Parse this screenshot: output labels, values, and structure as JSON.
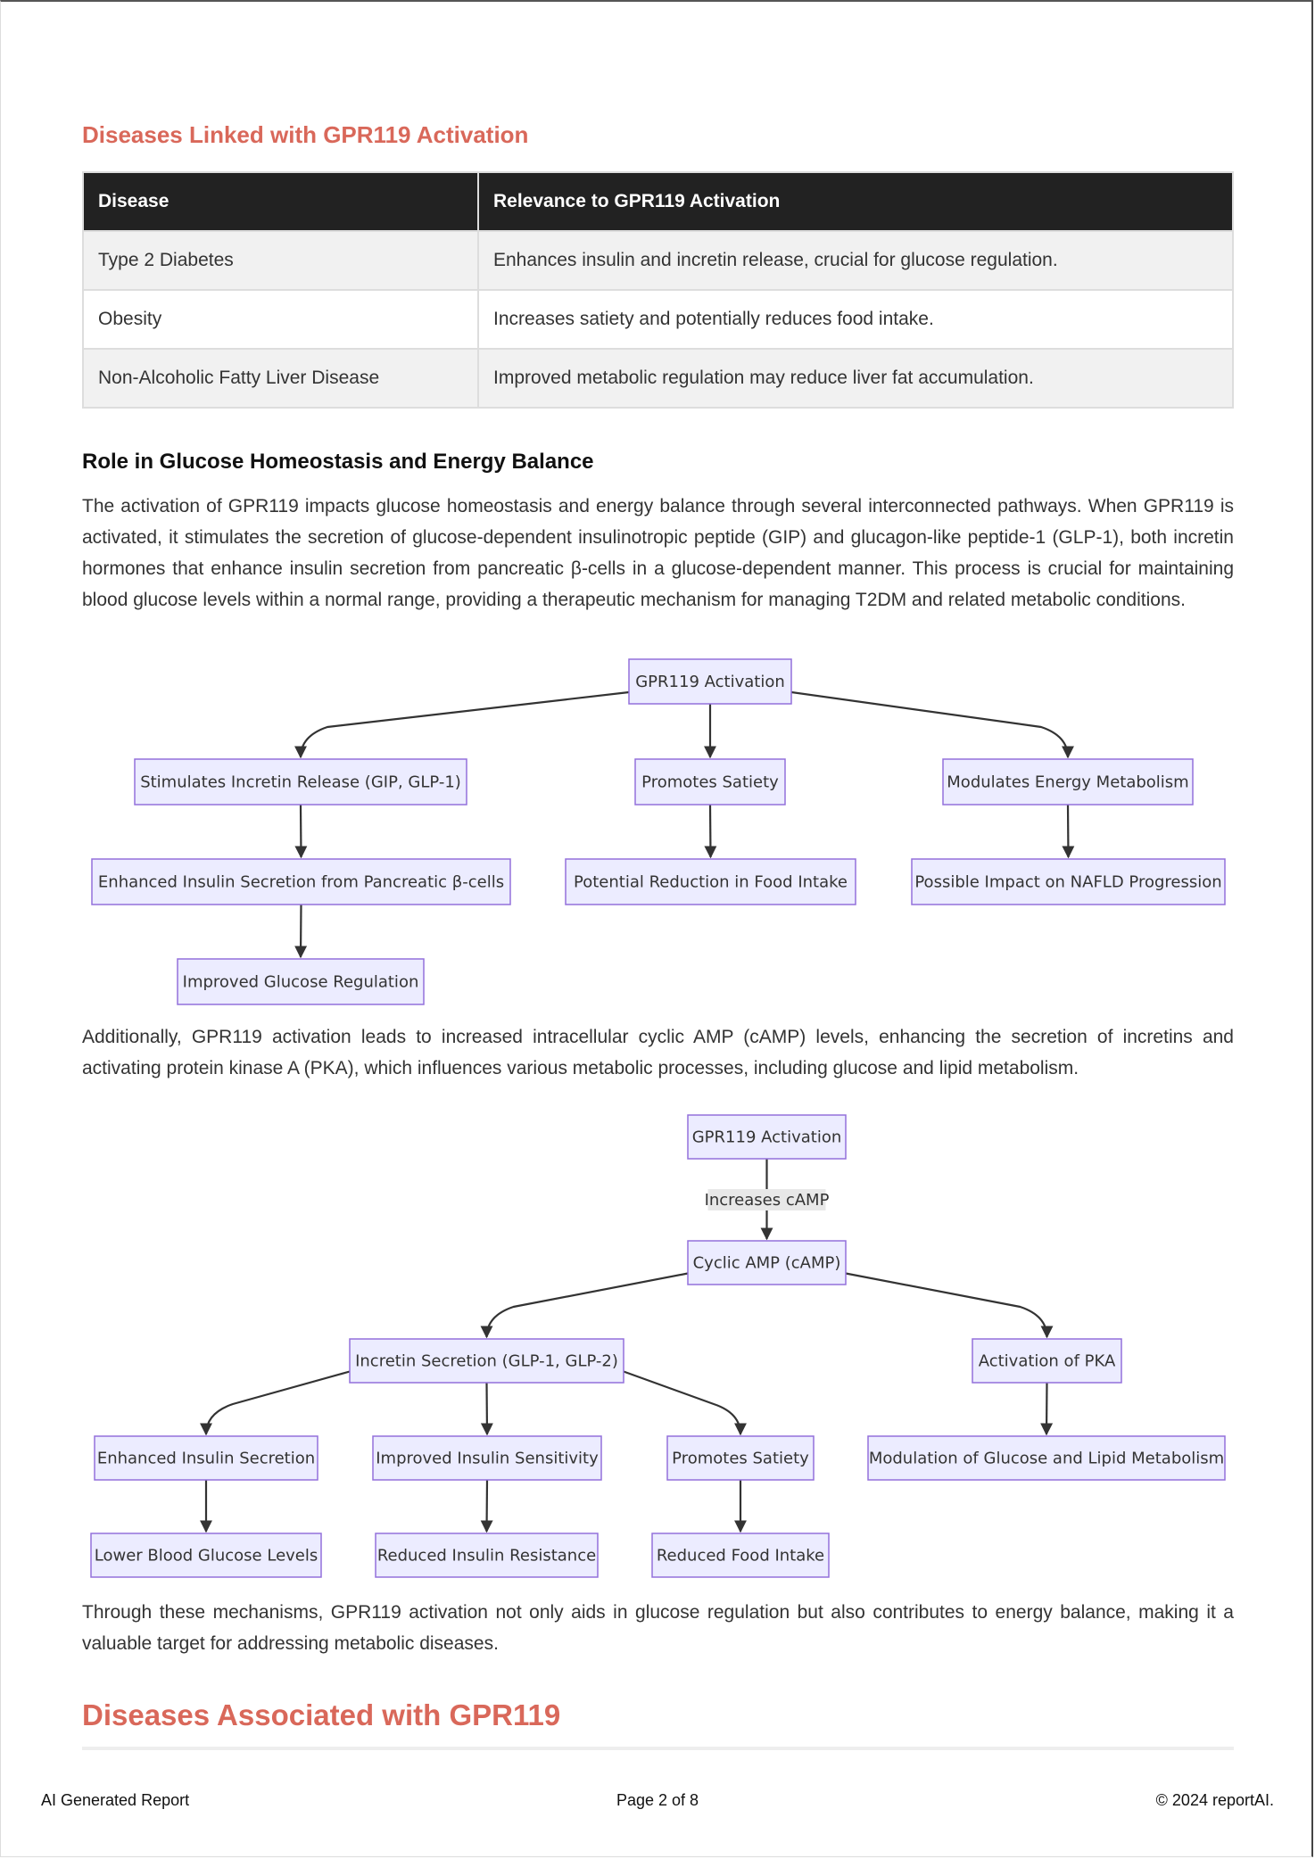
{
  "section_linked": {
    "title": "Diseases Linked with GPR119 Activation",
    "table": {
      "headers": [
        "Disease",
        "Relevance to GPR119 Activation"
      ],
      "rows": [
        [
          "Type 2 Diabetes",
          "Enhances insulin and incretin release, crucial for glucose regulation."
        ],
        [
          "Obesity",
          "Increases satiety and potentially reduces food intake."
        ],
        [
          "Non-Alcoholic Fatty Liver Disease",
          "Improved metabolic regulation may reduce liver fat accumulation."
        ]
      ]
    }
  },
  "section_role": {
    "title": "Role in Glucose Homeostasis and Energy Balance",
    "paragraph1": "The activation of GPR119 impacts glucose homeostasis and energy balance through several interconnected pathways. When GPR119 is activated, it stimulates the secretion of glucose-dependent insulinotropic peptide (GIP) and glucagon-like peptide-1 (GLP-1), both incretin hormones that enhance insulin secretion from pancreatic β-cells in a glucose-dependent manner. This process is crucial for maintaining blood glucose levels within a normal range, providing a therapeutic mechanism for managing T2DM and related metabolic conditions.",
    "paragraph2": "Additionally, GPR119 activation leads to increased intracellular cyclic AMP (cAMP) levels, enhancing the secretion of incretins and activating protein kinase A (PKA), which influences various metabolic processes, including glucose and lipid metabolism.",
    "paragraph3": "Through these mechanisms, GPR119 activation not only aids in glucose regulation but also contributes to energy balance, making it a valuable target for addressing metabolic diseases."
  },
  "diagram1": {
    "nodes": {
      "root": "GPR119 Activation",
      "incretin": "Stimulates Incretin Release (GIP, GLP-1)",
      "satiety": "Promotes Satiety",
      "energy": "Modulates Energy Metabolism",
      "insulin": "Enhanced Insulin Secretion from Pancreatic β-cells",
      "food": "Potential Reduction in Food Intake",
      "nafld": "Possible Impact on NAFLD Progression",
      "glucose": "Improved Glucose Regulation"
    },
    "edges": [
      [
        "root",
        "incretin"
      ],
      [
        "root",
        "satiety"
      ],
      [
        "root",
        "energy"
      ],
      [
        "incretin",
        "insulin"
      ],
      [
        "satiety",
        "food"
      ],
      [
        "energy",
        "nafld"
      ],
      [
        "insulin",
        "glucose"
      ]
    ]
  },
  "diagram2": {
    "nodes": {
      "root": "GPR119 Activation",
      "camp": "Cyclic AMP (cAMP)",
      "incretin": "Incretin Secretion (GLP-1, GLP-2)",
      "pka": "Activation of PKA",
      "insulin": "Enhanced Insulin Secretion",
      "sensitivity": "Improved Insulin Sensitivity",
      "satiety": "Promotes Satiety",
      "modulation": "Modulation of Glucose and Lipid Metabolism",
      "lower": "Lower Blood Glucose Levels",
      "resistance": "Reduced Insulin Resistance",
      "food": "Reduced Food Intake"
    },
    "edge_label": "Increases cAMP",
    "edges": [
      [
        "root",
        "camp"
      ],
      [
        "camp",
        "incretin"
      ],
      [
        "camp",
        "pka"
      ],
      [
        "incretin",
        "insulin"
      ],
      [
        "incretin",
        "sensitivity"
      ],
      [
        "incretin",
        "satiety"
      ],
      [
        "pka",
        "modulation"
      ],
      [
        "insulin",
        "lower"
      ],
      [
        "sensitivity",
        "resistance"
      ],
      [
        "satiety",
        "food"
      ]
    ]
  },
  "section_assoc": {
    "title": "Diseases Associated with GPR119"
  },
  "footer": {
    "left": "AI Generated Report",
    "center": "Page 2 of 8",
    "right": "© 2024 reportAI."
  }
}
